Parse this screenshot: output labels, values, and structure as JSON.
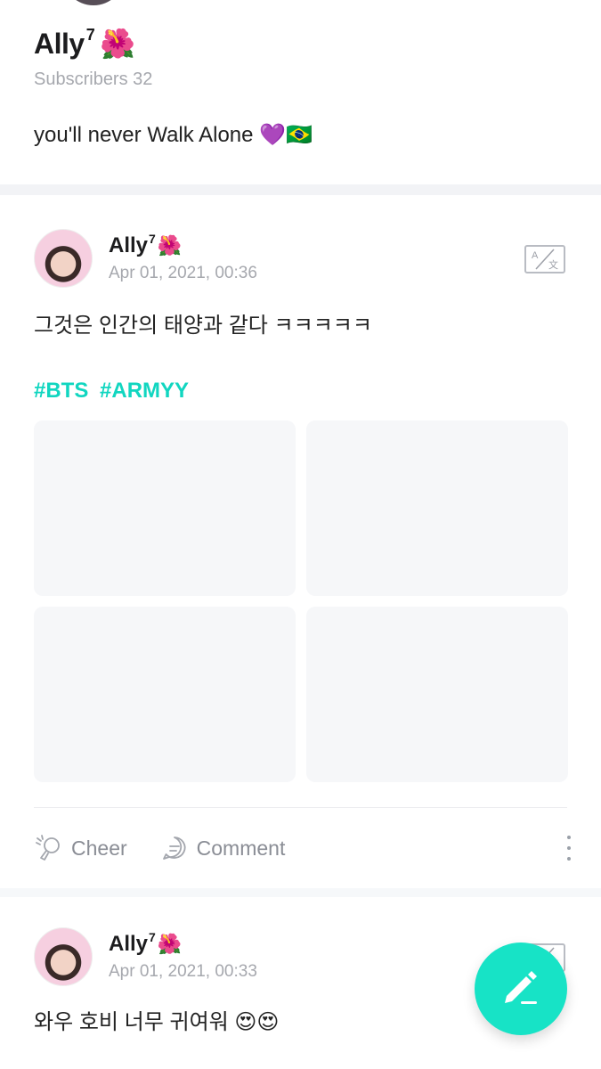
{
  "profile": {
    "name": "Ally",
    "name_sup": "7",
    "name_emoji": "🌺",
    "subscribers": "Subscribers 32",
    "bio": "you'll never Walk Alone 💜🇧🇷"
  },
  "posts": [
    {
      "author": "Ally",
      "author_sup": "7",
      "author_emoji": "🌺",
      "time": "Apr 01, 2021, 00:36",
      "body": "그것은 인간의 태양과 같다 ㅋㅋㅋㅋㅋ",
      "hashtags": [
        "#BTS",
        "#ARMYY"
      ],
      "actions": {
        "cheer": "Cheer",
        "comment": "Comment"
      }
    },
    {
      "author": "Ally",
      "author_sup": "7",
      "author_emoji": "🌺",
      "time": "Apr 01, 2021, 00:33",
      "body": "와우 호비 너무 귀여워 😍😍"
    }
  ],
  "icons": {
    "translate": "translate-icon",
    "cheer": "cheer-icon",
    "comment": "comment-icon",
    "more": "more-vertical-icon",
    "write": "pencil-icon"
  },
  "colors": {
    "accent": "#17e3c6",
    "hashtag": "#11d6c0",
    "muted_text": "#a6a8ae"
  }
}
